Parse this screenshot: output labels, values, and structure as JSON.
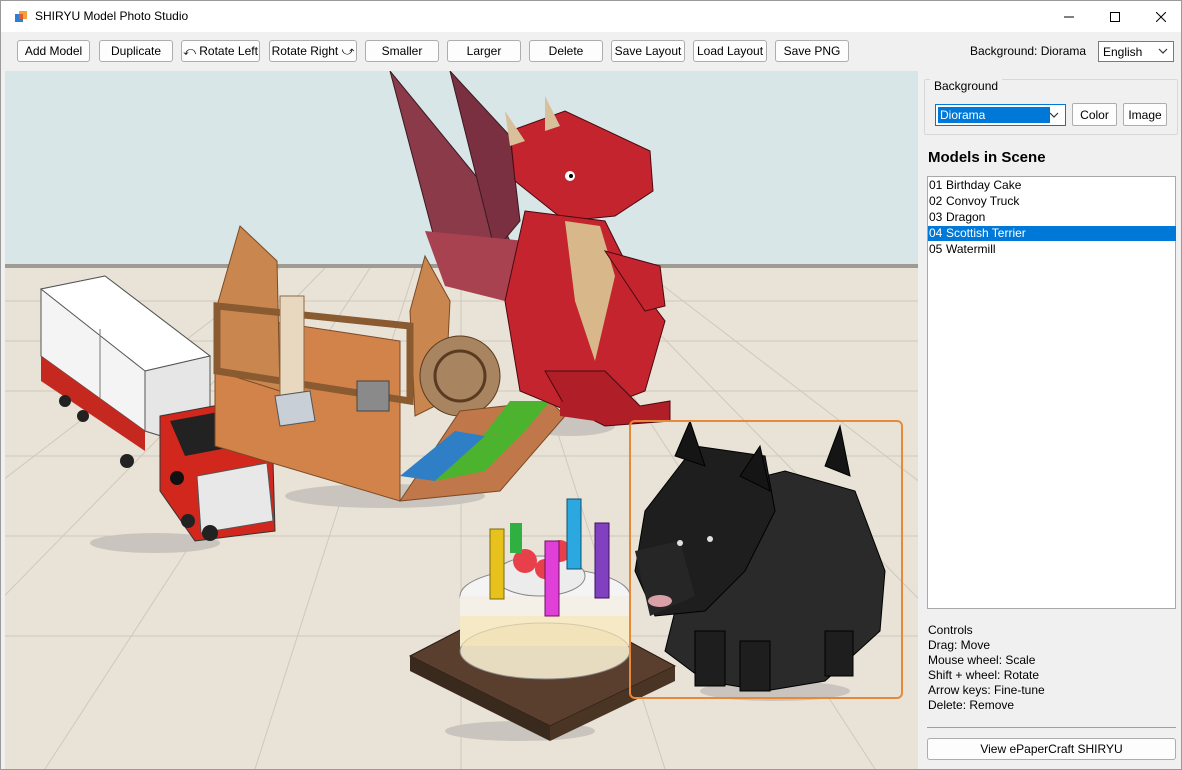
{
  "window": {
    "title": "SHIRYU Model Photo Studio"
  },
  "toolbar": {
    "add_model": "Add Model",
    "duplicate": "Duplicate",
    "rotate_left": "⤺ Rotate Left",
    "rotate_right": "Rotate Right ⤻",
    "smaller": "Smaller",
    "larger": "Larger",
    "delete": "Delete",
    "save_layout": "Save Layout",
    "load_layout": "Load Layout",
    "save_png": "Save PNG",
    "background_status": "Background: Diorama",
    "language": "English"
  },
  "background_panel": {
    "title": "Background",
    "selected": "Diorama",
    "color_button": "Color",
    "image_button": "Image"
  },
  "models": {
    "title": "Models in Scene",
    "items": [
      {
        "num": "01",
        "name": "Birthday Cake",
        "selected": false
      },
      {
        "num": "02",
        "name": "Convoy Truck",
        "selected": false
      },
      {
        "num": "03",
        "name": "Dragon",
        "selected": false
      },
      {
        "num": "04",
        "name": "Scottish Terrier",
        "selected": true
      },
      {
        "num": "05",
        "name": "Watermill",
        "selected": false
      }
    ]
  },
  "controls": {
    "title": "Controls",
    "lines": [
      "Drag: Move",
      "Mouse wheel: Scale",
      "Shift + wheel: Rotate",
      "Arrow keys: Fine-tune",
      "Delete: Remove"
    ]
  },
  "footer": {
    "link_button": "View ePaperCraft SHIRYU"
  },
  "colors": {
    "accent": "#0078d7",
    "selection_frame": "#e8893a",
    "wall": "#d8e6e8",
    "floor": "#e9e2d6"
  }
}
